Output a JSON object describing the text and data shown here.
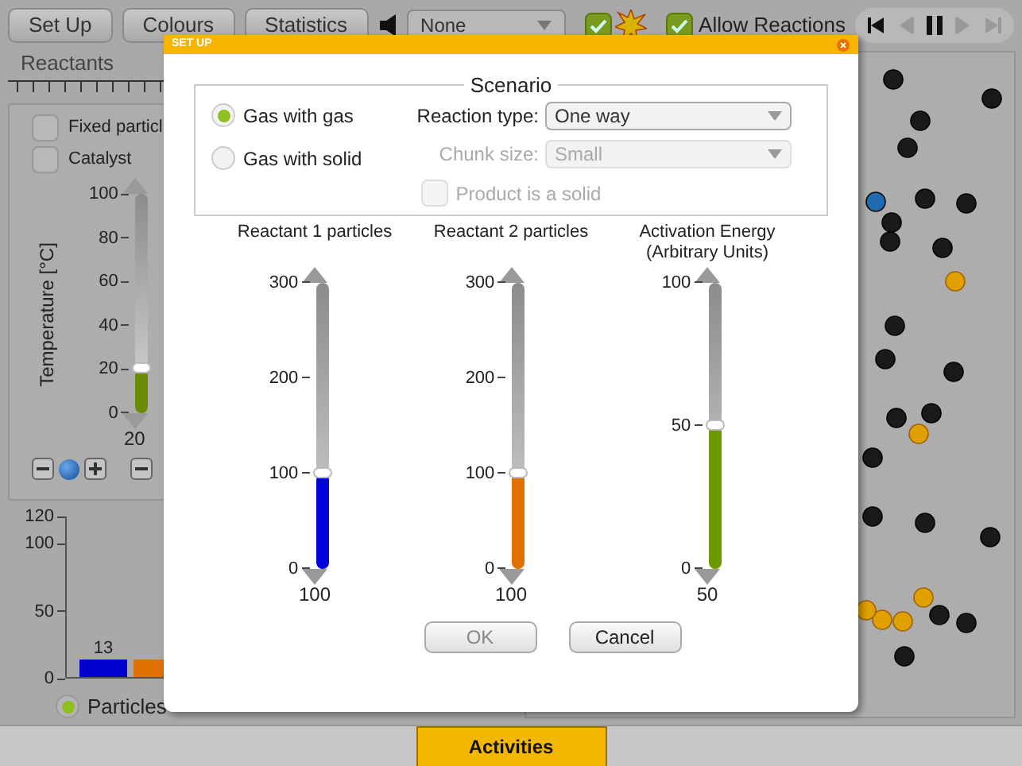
{
  "toolbar": {
    "buttons": [
      "Set Up",
      "Colours",
      "Statistics"
    ],
    "dropdown": {
      "value": "None"
    },
    "effects_checkbox": {
      "checked": true
    },
    "allow_reactions": {
      "label": "Allow Reactions",
      "checked": true
    }
  },
  "reactants_panel": {
    "tab": "Reactants",
    "options": [
      {
        "label": "Fixed particl",
        "checked": false
      },
      {
        "label": "Catalyst",
        "checked": false
      }
    ],
    "temperature": {
      "label": "Temperature [°C]",
      "ticks": [
        "100",
        "80",
        "60",
        "40",
        "20",
        "0"
      ],
      "level": 0.2,
      "color": "#6a8a00",
      "reading": "20"
    }
  },
  "chart": {
    "chart_data": {
      "type": "bar",
      "ylim": [
        0,
        120
      ],
      "yticks": [
        0,
        50,
        100,
        120
      ],
      "value_labels": [
        "13",
        null
      ],
      "series": [
        {
          "color": "#0000cc",
          "values": [
            13
          ]
        },
        {
          "color": "#e07000",
          "values": [
            13
          ]
        }
      ]
    }
  },
  "view_options": [
    {
      "label": "Particles",
      "selected": true
    }
  ],
  "bottom_tab": "Activities",
  "dialog": {
    "title": "SET UP",
    "scenario": {
      "title": "Scenario",
      "modes": [
        {
          "label": "Gas with gas",
          "selected": true
        },
        {
          "label": "Gas with solid",
          "selected": false
        }
      ],
      "reaction_type": {
        "label": "Reaction type:",
        "value": "One way",
        "disabled": false
      },
      "chunk_size": {
        "label": "Chunk size:",
        "value": "Small",
        "disabled": true
      },
      "product_solid": {
        "label": "Product is a solid",
        "checked": false,
        "disabled": true
      }
    },
    "sliders": [
      {
        "label": "Reactant 1 particles",
        "ticks": [
          "300",
          "200",
          "100",
          "0"
        ],
        "level": 0.333,
        "color": "#0000dd",
        "reading": "100"
      },
      {
        "label": "Reactant 2 particles",
        "ticks": [
          "300",
          "200",
          "100",
          "0"
        ],
        "level": 0.333,
        "color": "#e07000",
        "reading": "100"
      },
      {
        "label": "Activation Energy (Arbitrary Units)",
        "ticks": [
          "100",
          "50",
          "0"
        ],
        "level": 0.5,
        "color": "#6a9a00",
        "reading": "50"
      }
    ],
    "buttons": [
      {
        "label": "OK",
        "disabled": true
      },
      {
        "label": "Cancel",
        "disabled": false
      }
    ]
  }
}
